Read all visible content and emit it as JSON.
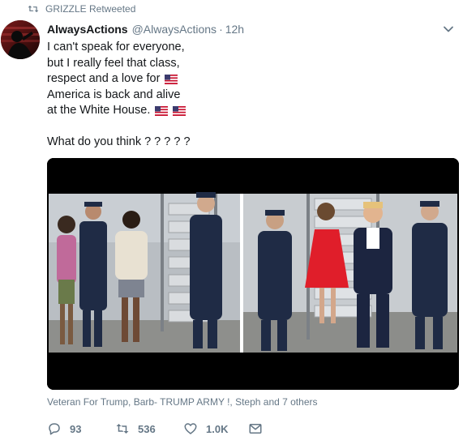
{
  "retweet_header": {
    "text": "GRIZZLE Retweeted",
    "icon": "retweet-icon"
  },
  "author": {
    "display_name": "AlwaysActions",
    "handle": "@AlwaysActions",
    "separator": "·",
    "time": "12h"
  },
  "tweet": {
    "lines": [
      "I can't speak for everyone,",
      "but I really feel that class,",
      "respect and a love for",
      "America is back and alive",
      "at the White House."
    ],
    "question": "What do you think ? ? ? ? ?"
  },
  "liked_by": "Veteran For Trump, Barb- TRUMP ARMY !, Steph and 7 others",
  "actions": {
    "replies": "93",
    "retweets": "536",
    "likes": "1.0K"
  },
  "colors": {
    "secondary_text": "#657786",
    "primary_text": "#14171a",
    "flag_red": "#c8102e",
    "flag_blue": "#3c3b6e"
  }
}
